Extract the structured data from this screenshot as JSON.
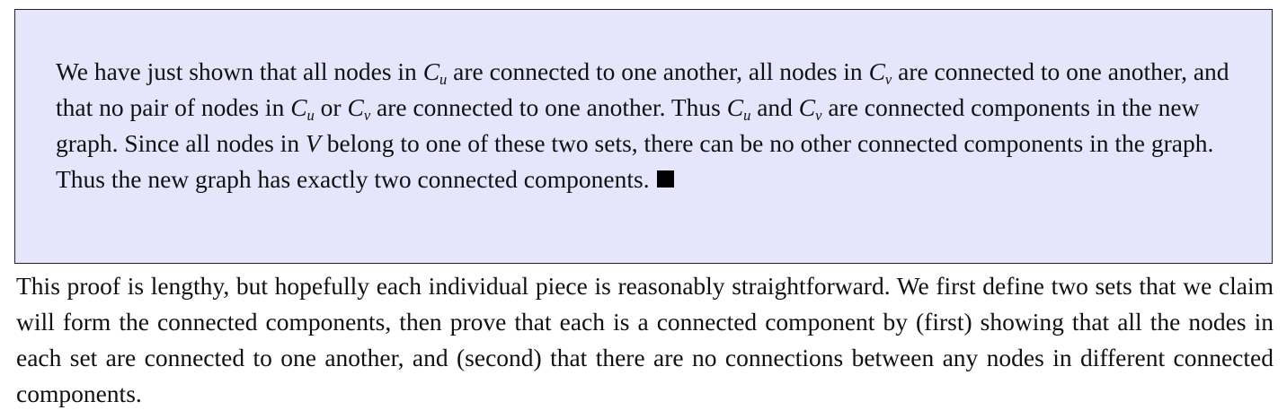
{
  "proof": {
    "s1a": "We have just shown that all nodes in ",
    "m1": "C",
    "m1sub": "u",
    "s1b": " are connected to one another, all nodes in ",
    "m2": "C",
    "m2sub": "v",
    "s1c": " are connected to one another, and that no pair of nodes in ",
    "m3": "C",
    "m3sub": "u",
    "s1d": " or ",
    "m4": "C",
    "m4sub": "v",
    "s1e": " are connected to one another.  Thus ",
    "m5": "C",
    "m5sub": "u",
    "s1f": " and ",
    "m6": "C",
    "m6sub": "v",
    "s1g": " are connected components in the new graph.  Since all nodes in ",
    "m7": "V",
    "s1h": " belong to one of these two sets, there can be no other connected components in the graph.  Thus the new graph has exactly two connected components."
  },
  "after": {
    "paragraph": "This proof is lengthy, but hopefully each individual piece is reasonably straightforward.  We first define two sets that we claim will form the connected components, then prove that each is a connected component by (first) showing that all the nodes in each set are connected to one another, and (second) that there are no connections between any nodes in different connected components."
  },
  "colors": {
    "box_background": "#e5e5fb",
    "box_border": "#222222",
    "text": "#111111"
  },
  "icons": {
    "qed": "filled-square"
  }
}
